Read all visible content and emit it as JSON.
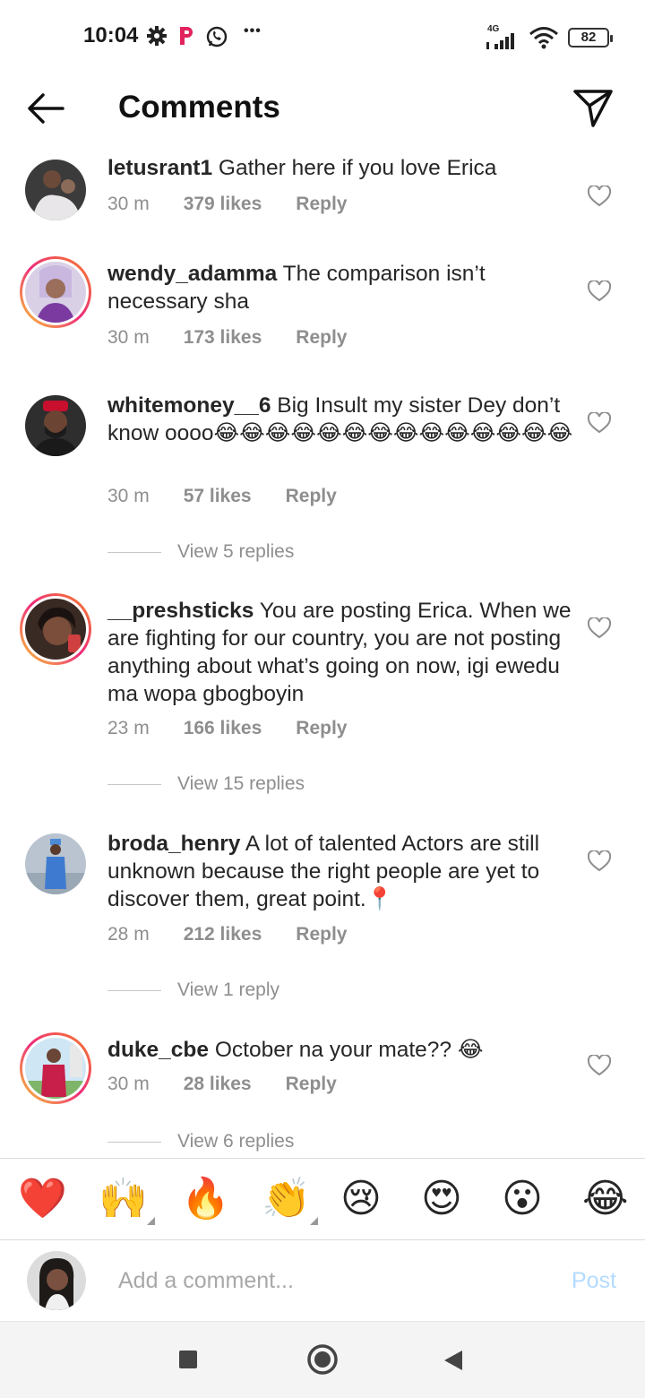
{
  "status_bar": {
    "time": "10:04",
    "network": "4G",
    "battery": "82",
    "icons": [
      "settings-gear-icon",
      "p-app-icon",
      "whatsapp-icon",
      "more-dots-icon",
      "signal-icon",
      "wifi-icon",
      "battery-icon"
    ],
    "more": "•••"
  },
  "header": {
    "title": "Comments",
    "back_icon": "arrow-left-icon",
    "share_icon": "paper-plane-icon"
  },
  "comments": [
    {
      "username": "letusrant1",
      "text": " Gather here if you love Erica",
      "time": "30 m",
      "likes": "379 likes",
      "reply": "Reply"
    },
    {
      "username": "wendy_adamma",
      "text": " The comparison isn’t necessary sha",
      "time": "30 m",
      "likes": "173 likes",
      "reply": "Reply"
    },
    {
      "username": "whitemoney__6",
      "text": " Big Insult my sister Dey don’t know oooo😂😂😂😂😂😂😂😂😂😂😂😂😂😂",
      "time": "30 m",
      "likes": "57 likes",
      "reply": "Reply",
      "view_replies": "View 5 replies"
    },
    {
      "username": "__preshsticks",
      "text": " You are posting Erica. When we are fighting for our country, you are not posting anything about what’s going on now, igi ewedu ma wopa gbogboyin",
      "time": "23 m",
      "likes": "166 likes",
      "reply": "Reply",
      "view_replies": "View 15 replies"
    },
    {
      "username": "broda_henry",
      "text": " A lot of talented Actors are still unknown because the right people are yet to discover them, great point.📍",
      "time": "28 m",
      "likes": "212 likes",
      "reply": "Reply",
      "view_replies": "View 1 reply"
    },
    {
      "username": "duke_cbe",
      "text": " October na your mate?? 😂",
      "time": "30 m",
      "likes": "28 likes",
      "reply": "Reply",
      "view_replies": "View 6 replies"
    }
  ],
  "emoji_bar": [
    "❤️",
    "🙌",
    "🔥",
    "👏",
    "😢",
    "😍",
    "😮",
    "😂"
  ],
  "add_comment": {
    "placeholder": "Add a comment...",
    "post_label": "Post"
  },
  "colors": {
    "text": "#262626",
    "secondary": "#8e8e8e",
    "post_disabled": "#b3dbff",
    "story_ring": "#ee2a7b"
  }
}
